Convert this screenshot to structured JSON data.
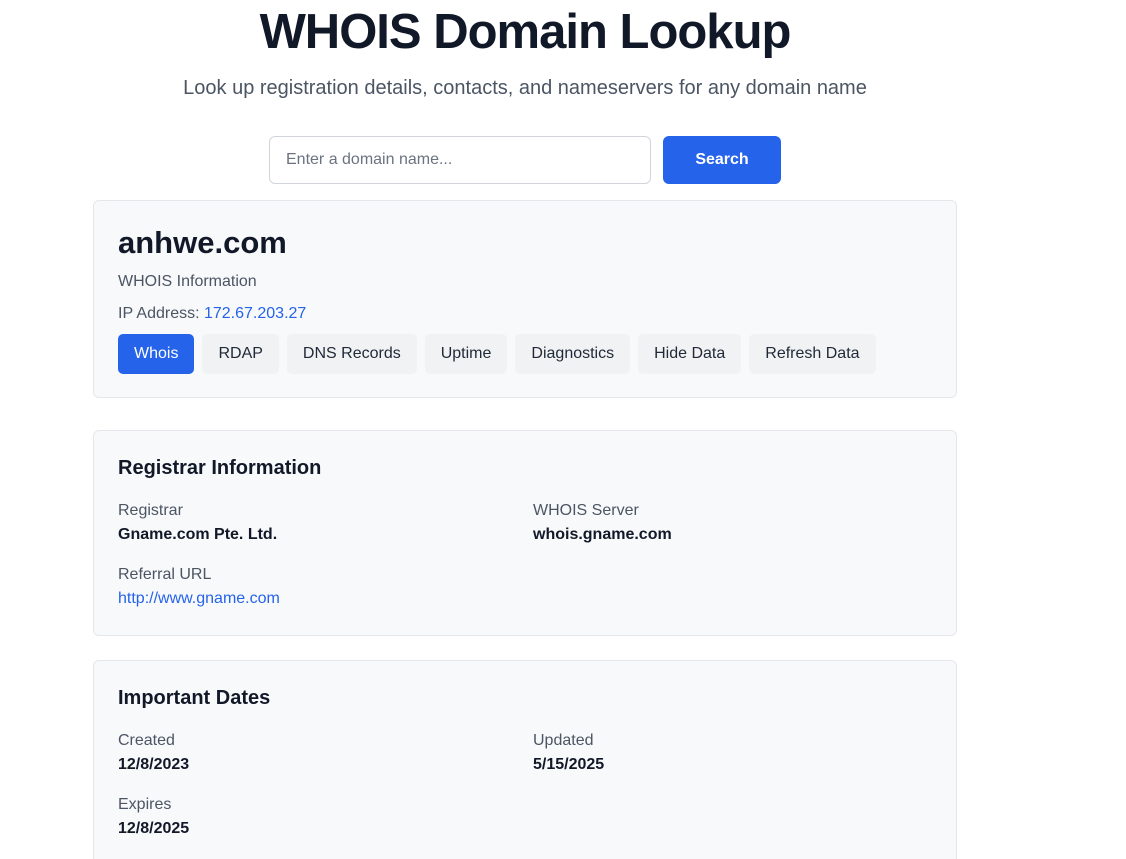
{
  "header": {
    "title": "WHOIS Domain Lookup",
    "subtitle": "Look up registration details, contacts, and nameservers for any domain name"
  },
  "search": {
    "placeholder": "Enter a domain name...",
    "value": "",
    "button_label": "Search"
  },
  "domain": {
    "name": "anhwe.com",
    "info_label": "WHOIS Information",
    "ip_label": "IP Address:",
    "ip_value": "172.67.203.27"
  },
  "tabs": [
    {
      "label": "Whois",
      "active": true
    },
    {
      "label": "RDAP",
      "active": false
    },
    {
      "label": "DNS Records",
      "active": false
    },
    {
      "label": "Uptime",
      "active": false
    },
    {
      "label": "Diagnostics",
      "active": false
    },
    {
      "label": "Hide Data",
      "active": false
    },
    {
      "label": "Refresh Data",
      "active": false
    }
  ],
  "registrar": {
    "title": "Registrar Information",
    "registrar_label": "Registrar",
    "registrar_value": "Gname.com Pte. Ltd.",
    "whois_server_label": "WHOIS Server",
    "whois_server_value": "whois.gname.com",
    "referral_url_label": "Referral URL",
    "referral_url_value": "http://www.gname.com"
  },
  "dates": {
    "title": "Important Dates",
    "created_label": "Created",
    "created_value": "12/8/2023",
    "updated_label": "Updated",
    "updated_value": "5/15/2025",
    "expires_label": "Expires",
    "expires_value": "12/8/2025"
  },
  "colors": {
    "accent": "#2563eb",
    "card_background": "#f8f9fb",
    "tab_background": "#f1f2f4"
  }
}
